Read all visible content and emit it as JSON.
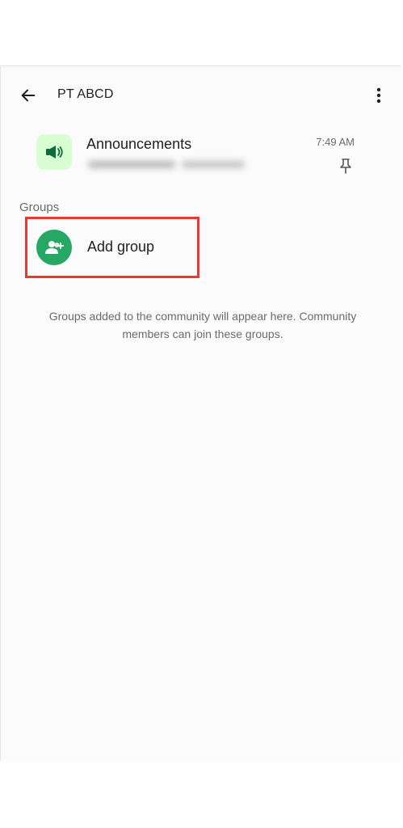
{
  "header": {
    "title": "PT ABCD",
    "back_icon": "arrow-left-icon",
    "menu_icon": "more-vertical-icon"
  },
  "announcements": {
    "name": "Announcements",
    "time": "7:49 AM",
    "icon": "megaphone-icon",
    "pin_icon": "pin-icon",
    "accent_color": "#d8fdd2"
  },
  "groups": {
    "section_label": "Groups",
    "add_group_label": "Add group",
    "add_group_icon": "add-group-icon",
    "add_group_color": "#25a863",
    "highlight_color": "#e53935"
  },
  "info": {
    "text": "Groups added to the community will appear here. Community members can join these groups."
  }
}
